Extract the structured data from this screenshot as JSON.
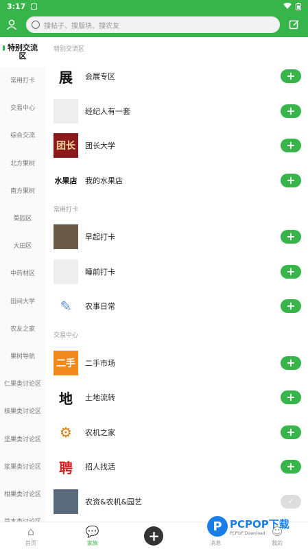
{
  "status": {
    "time": "3:17"
  },
  "search": {
    "placeholder": "搜帖子、搜版块、搜农友"
  },
  "sidebar": {
    "items": [
      {
        "label": "特别交流区",
        "active": true
      },
      {
        "label": "常用打卡"
      },
      {
        "label": "交易中心"
      },
      {
        "label": "综合交流"
      },
      {
        "label": "北方果树"
      },
      {
        "label": "南方果树"
      },
      {
        "label": "菜园区"
      },
      {
        "label": "大田区"
      },
      {
        "label": "中药材区"
      },
      {
        "label": "田间大学"
      },
      {
        "label": "农友之家"
      },
      {
        "label": "果树导航"
      },
      {
        "label": "仁果类讨论区"
      },
      {
        "label": "核果类讨论区"
      },
      {
        "label": "坚果类讨论区"
      },
      {
        "label": "浆果类讨论区"
      },
      {
        "label": "柑果类讨论区"
      },
      {
        "label": "草本类讨论区"
      }
    ]
  },
  "sections": [
    {
      "title": "特别交流区",
      "rows": [
        {
          "label": "会展专区",
          "thumb": "展",
          "thumb_bg": "#ffffff",
          "thumb_color": "#111"
        },
        {
          "label": "经纪人有一套",
          "thumb": "",
          "thumb_bg": "#eeeeee",
          "thumb_color": "#111"
        },
        {
          "label": "团长大学",
          "thumb": "团长",
          "thumb_bg": "#8b1a1a",
          "thumb_color": "#f5d9a0"
        },
        {
          "label": "我的水果店",
          "thumb": "水果店",
          "thumb_bg": "#ffffff",
          "thumb_color": "#111"
        }
      ]
    },
    {
      "title": "常用打卡",
      "rows": [
        {
          "label": "早起打卡",
          "thumb": "",
          "thumb_bg": "#6b5a4a",
          "thumb_color": "#fff"
        },
        {
          "label": "睡前打卡",
          "thumb": "",
          "thumb_bg": "#eeeeee",
          "thumb_color": "#111"
        },
        {
          "label": "农事日常",
          "thumb": "✎",
          "thumb_bg": "#ffffff",
          "thumb_color": "#5a8fd6"
        }
      ]
    },
    {
      "title": "交易中心",
      "rows": [
        {
          "label": "二手市场",
          "thumb": "二手",
          "thumb_bg": "#f08a1c",
          "thumb_color": "#fff"
        },
        {
          "label": "土地流转",
          "thumb": "地",
          "thumb_bg": "#ffffff",
          "thumb_color": "#111"
        },
        {
          "label": "农机之家",
          "thumb": "⚙",
          "thumb_bg": "#ffffff",
          "thumb_color": "#e07b00"
        },
        {
          "label": "招人找活",
          "thumb": "聘",
          "thumb_bg": "#ffffff",
          "thumb_color": "#d42020"
        },
        {
          "label": "农资&农机&园艺",
          "thumb": "",
          "thumb_bg": "#5a6a7a",
          "thumb_color": "#fff",
          "done": true
        }
      ]
    }
  ],
  "tabbar": {
    "items": [
      {
        "label": "首页",
        "icon": "home-icon"
      },
      {
        "label": "家族",
        "icon": "chat-icon",
        "active": true
      },
      {
        "label": "",
        "icon": "plus-icon"
      },
      {
        "label": "消息",
        "icon": "message-icon"
      },
      {
        "label": "我的",
        "icon": "profile-icon"
      }
    ]
  },
  "colors": {
    "accent": "#37b54a"
  },
  "watermark": {
    "brand": "PCPOP下载",
    "logo": "P",
    "sub": "PCPOP Download"
  }
}
